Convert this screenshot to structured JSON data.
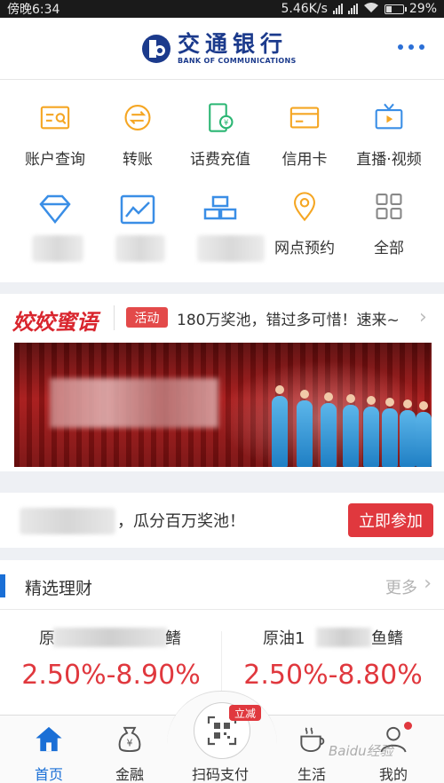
{
  "status_bar": {
    "carrier": "傍晚6:34",
    "speed": "5.46K/s",
    "battery": "29%"
  },
  "header": {
    "logo_cn": "交通银行",
    "logo_en": "BANK OF COMMUNICATIONS",
    "more_icon": "more-dots-icon"
  },
  "grid": {
    "row1": [
      {
        "label": "账户查询",
        "icon": "account-query-icon"
      },
      {
        "label": "转账",
        "icon": "transfer-icon"
      },
      {
        "label": "话费充值",
        "icon": "phone-recharge-icon"
      },
      {
        "label": "信用卡",
        "icon": "credit-card-icon"
      },
      {
        "label": "直播·视频",
        "icon": "live-video-icon"
      }
    ],
    "row2": [
      {
        "label": "",
        "icon": "diamond-icon"
      },
      {
        "label": "",
        "icon": "chart-icon"
      },
      {
        "label": "",
        "icon": "gold-bars-icon"
      },
      {
        "label": "网点预约",
        "icon": "location-pin-icon"
      },
      {
        "label": "全部",
        "icon": "all-grid-icon"
      }
    ]
  },
  "promo": {
    "brand": "姣姣蜜语",
    "tag": "活动",
    "text": "180万奖池，错过多可惜！速来~"
  },
  "join": {
    "text": "，瓜分百万奖池！",
    "button": "立即参加"
  },
  "wealth": {
    "title": "精选理财",
    "more": "更多",
    "products": [
      {
        "name_prefix": "原",
        "name_suffix": "鳍",
        "rate": "2.50%-8.90%"
      },
      {
        "name_prefix": "原油1",
        "name_suffix": "鱼鳍",
        "rate": "2.50%-8.80%"
      }
    ]
  },
  "nav": {
    "items": [
      {
        "label": "首页",
        "icon": "home-icon"
      },
      {
        "label": "金融",
        "icon": "money-bag-icon"
      },
      {
        "label": "扫码支付",
        "icon": "scan-pay-icon"
      },
      {
        "label": "生活",
        "icon": "coffee-cup-icon"
      },
      {
        "label": "我的",
        "icon": "profile-icon"
      }
    ],
    "scan_badge": "立减"
  },
  "watermark": "Baidu经验",
  "colors": {
    "accent_blue": "#1a6fd6",
    "accent_red": "#e0383e",
    "icon_orange": "#f5a623",
    "icon_green": "#2bb673"
  }
}
